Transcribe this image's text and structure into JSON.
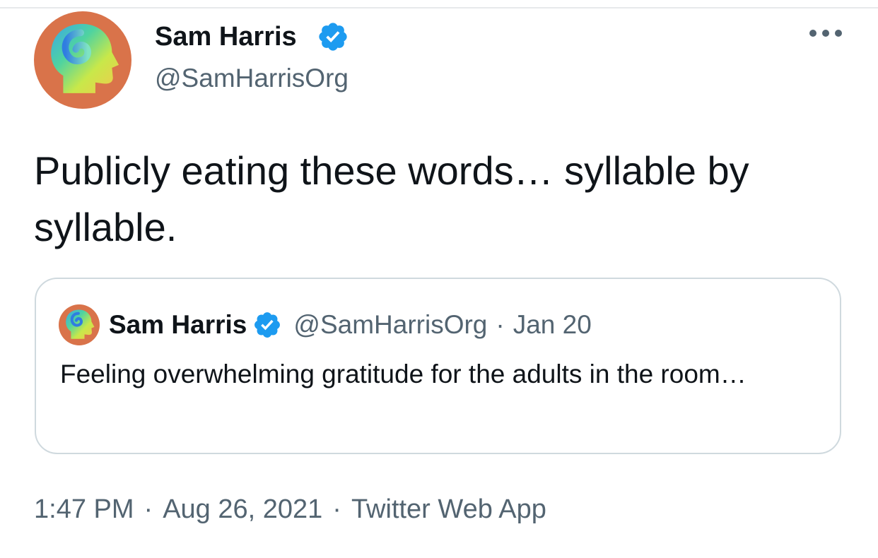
{
  "tweet": {
    "author_name": "Sam Harris",
    "author_handle": "@SamHarrisOrg",
    "text": "Publicly eating these words… syllable by syllable.",
    "time": "1:47 PM",
    "date": "Aug 26, 2021",
    "source": "Twitter Web App",
    "separator": "·"
  },
  "quoted_tweet": {
    "author_name": "Sam Harris",
    "author_handle": "@SamHarrisOrg",
    "separator": "·",
    "date": "Jan 20",
    "text": "Feeling overwhelming gratitude for the adults in the room…"
  },
  "icons": {
    "verified": "verified-badge-icon",
    "more": "more-options-icon",
    "avatar": "head-profile-avatar"
  },
  "colors": {
    "verified_blue": "#1d9bf0",
    "secondary_text": "#536471",
    "primary_text": "#0f1419",
    "card_border": "#cfd9de",
    "avatar_background": "#d9734a"
  }
}
